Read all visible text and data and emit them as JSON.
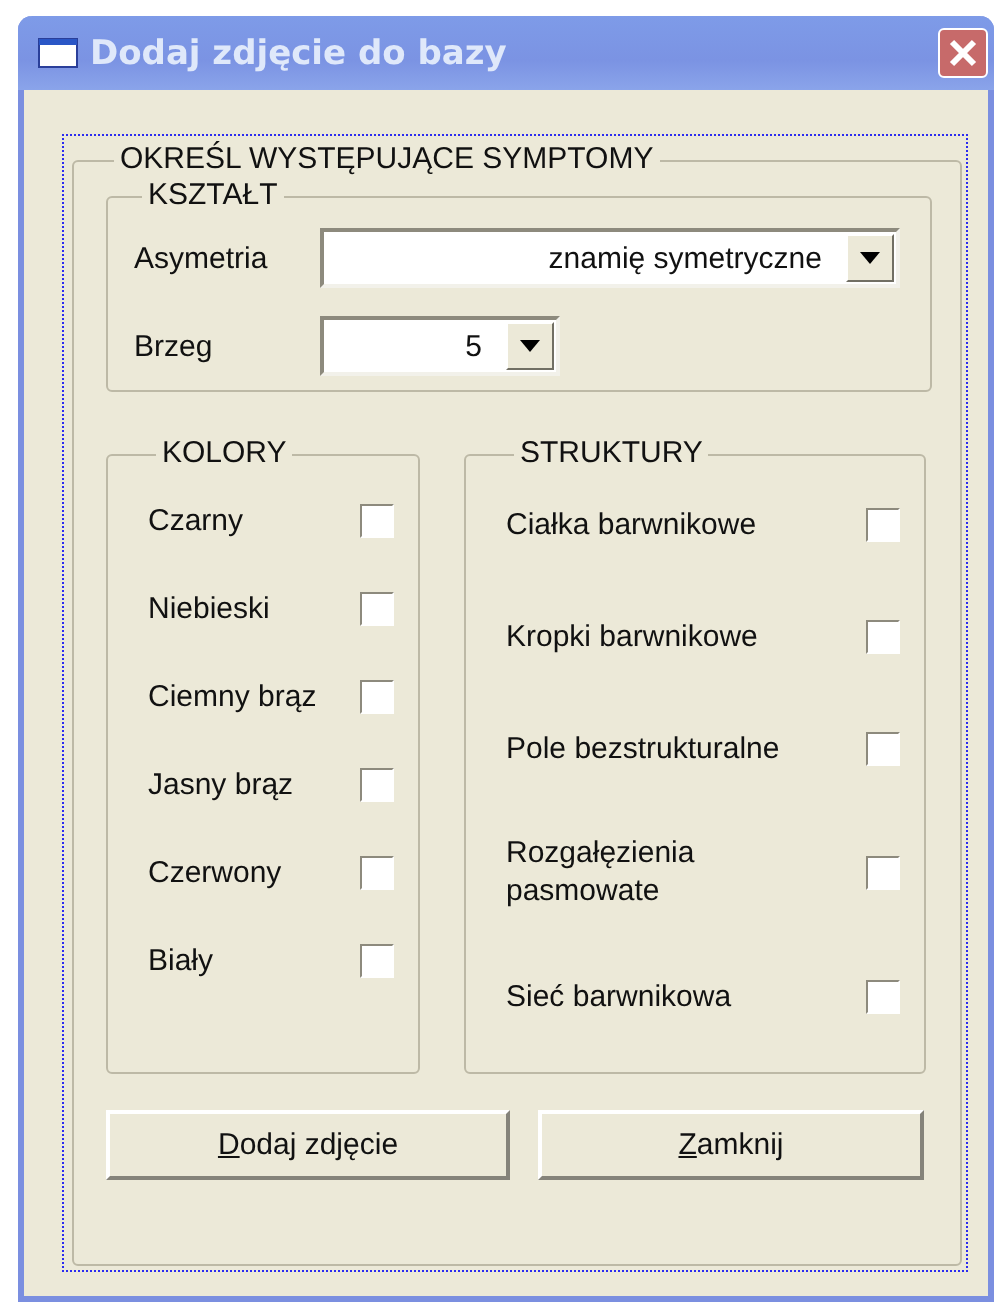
{
  "window": {
    "title": "Dodaj zdjęcie do bazy"
  },
  "main_group": {
    "title": "OKREŚL WYSTĘPUJĄCE SYMPTOMY"
  },
  "shape_group": {
    "title": "KSZTAŁT",
    "fields": [
      {
        "label": "Asymetria",
        "value": "znamię symetryczne",
        "kind": "wide"
      },
      {
        "label": "Brzeg",
        "value": "5",
        "kind": "narrow"
      }
    ]
  },
  "colors_group": {
    "title": "KOLORY",
    "items": [
      {
        "label": "Czarny",
        "checked": false
      },
      {
        "label": "Niebieski",
        "checked": false
      },
      {
        "label": "Ciemny brąz",
        "checked": false
      },
      {
        "label": "Jasny brąz",
        "checked": false
      },
      {
        "label": "Czerwony",
        "checked": false
      },
      {
        "label": "Biały",
        "checked": false
      }
    ]
  },
  "structures_group": {
    "title": "STRUKTURY",
    "items": [
      {
        "label": "Ciałka barwnikowe",
        "checked": false
      },
      {
        "label": "Kropki barwnikowe",
        "checked": false
      },
      {
        "label": "Pole bezstrukturalne",
        "checked": false
      },
      {
        "label": "Rozgałęzienia pasmowate",
        "checked": false
      },
      {
        "label": "Sieć barwnikowa",
        "checked": false
      }
    ]
  },
  "buttons": [
    "Dodaj zdjęcie",
    "Zamknij"
  ]
}
